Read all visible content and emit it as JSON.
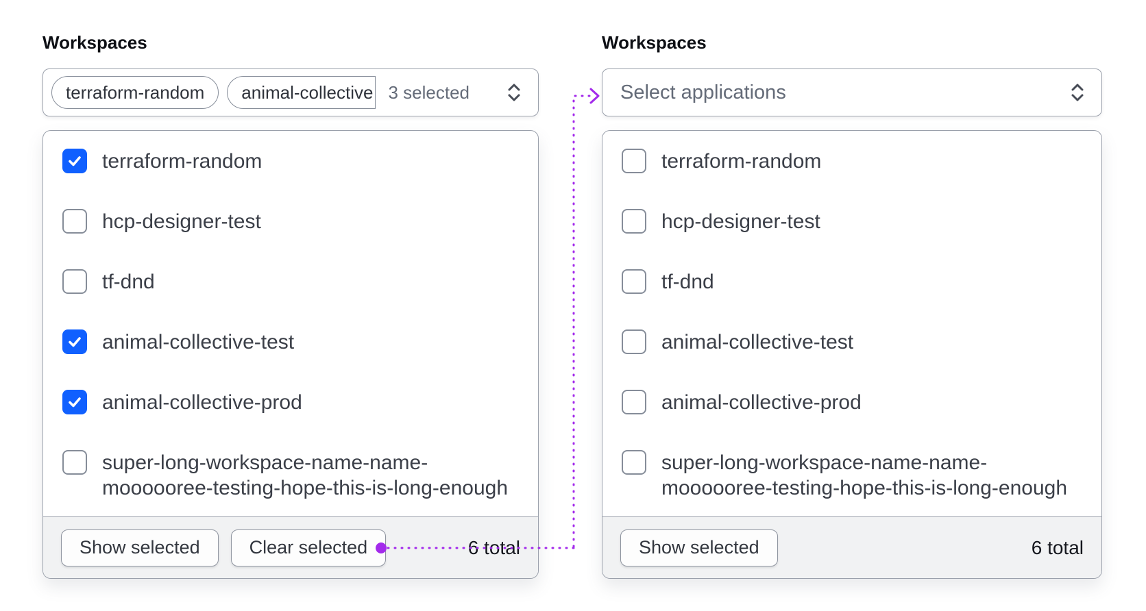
{
  "left_panel": {
    "label": "Workspaces",
    "trigger": {
      "tags": [
        {
          "text": "terraform-random",
          "clipped": false
        },
        {
          "text": "animal-collective",
          "clipped": true
        }
      ],
      "summary": "3 selected",
      "chevron_icon": "chevron-up-down"
    },
    "options": [
      {
        "lines": [
          "terraform-random"
        ],
        "checked": true
      },
      {
        "lines": [
          "hcp-designer-test"
        ],
        "checked": false
      },
      {
        "lines": [
          "tf-dnd"
        ],
        "checked": false
      },
      {
        "lines": [
          "animal-collective-test"
        ],
        "checked": true
      },
      {
        "lines": [
          "animal-collective-prod"
        ],
        "checked": true
      },
      {
        "lines": [
          "super-long-workspace-name-name-",
          "moooooree-testing-hope-this-is-long-enough"
        ],
        "checked": false
      }
    ],
    "footer": {
      "buttons": [
        "Show selected",
        "Clear selected"
      ],
      "total": "6 total"
    }
  },
  "right_panel": {
    "label": "Workspaces",
    "trigger": {
      "placeholder": "Select applications",
      "chevron_icon": "chevron-up-down"
    },
    "options": [
      {
        "lines": [
          "terraform-random"
        ],
        "checked": false
      },
      {
        "lines": [
          "hcp-designer-test"
        ],
        "checked": false
      },
      {
        "lines": [
          "tf-dnd"
        ],
        "checked": false
      },
      {
        "lines": [
          "animal-collective-test"
        ],
        "checked": false
      },
      {
        "lines": [
          "animal-collective-prod"
        ],
        "checked": false
      },
      {
        "lines": [
          "super-long-workspace-name-name-",
          "moooooree-testing-hope-this-is-long-enough"
        ],
        "checked": false
      }
    ],
    "footer": {
      "buttons": [
        "Show selected"
      ],
      "total": "6 total"
    }
  },
  "colors": {
    "checkbox_checked": "#1060ff",
    "connector_purple": "#a32aeb",
    "border": "#9aa0ab",
    "footer_bg": "#f1f2f3",
    "text_primary": "#3b3f48",
    "text_muted": "#656c79"
  }
}
